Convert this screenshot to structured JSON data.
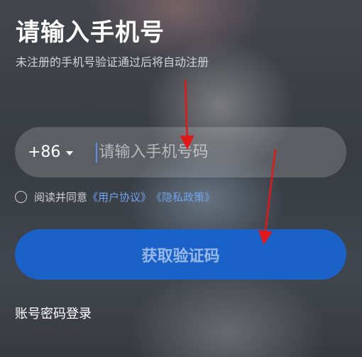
{
  "header": {
    "title": "请输入手机号",
    "subtitle": "未注册的手机号验证通过后将自动注册"
  },
  "phone": {
    "country_code": "+86",
    "placeholder": "请输入手机号码",
    "value": ""
  },
  "agreement": {
    "checked": false,
    "prefix": "阅读并同意",
    "user_agreement": "《用户协议》",
    "privacy_policy": "《隐私政策》"
  },
  "actions": {
    "get_code_label": "获取验证码",
    "password_login_label": "账号密码登录"
  },
  "colors": {
    "primary_button": "#1a62c8",
    "link": "#6fa4ee",
    "annotation_arrow": "#e01818"
  },
  "icons": {
    "dropdown": "caret-down-icon",
    "checkbox": "radio-circle-icon"
  }
}
